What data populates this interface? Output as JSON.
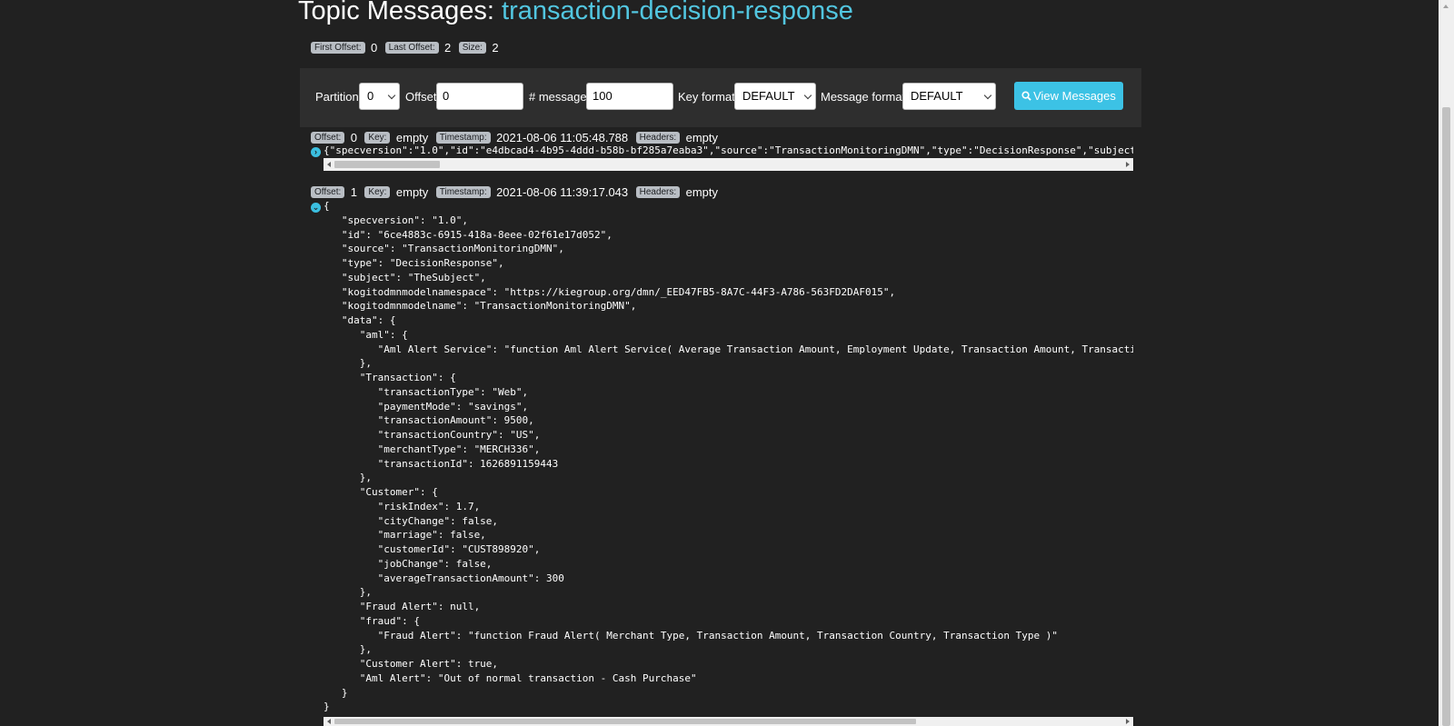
{
  "header": {
    "title_prefix": "Topic Messages: ",
    "topic_name": "transaction-decision-response"
  },
  "stats": {
    "first_offset_label": "First Offset:",
    "first_offset": "0",
    "last_offset_label": "Last Offset:",
    "last_offset": "2",
    "size_label": "Size:",
    "size": "2"
  },
  "controls": {
    "partition_label": "Partition",
    "partition_value": "0",
    "offset_label": "Offset",
    "offset_value": "0",
    "messages_label": "# messages",
    "messages_value": "100",
    "key_format_label": "Key format",
    "key_format_value": "DEFAULT",
    "message_format_label": "Message format",
    "message_format_value": "DEFAULT",
    "view_button_label": "View Messages",
    "view_button_icon": "search-icon"
  },
  "messages": [
    {
      "offset_label": "Offset:",
      "offset": "0",
      "key_label": "Key:",
      "key": "empty",
      "timestamp_label": "Timestamp:",
      "timestamp": "2021-08-06 11:05:48.788",
      "headers_label": "Headers:",
      "headers": "empty",
      "expanded": false,
      "body": "{\"specversion\":\"1.0\",\"id\":\"e4dbcad4-4b95-4ddd-b58b-bf285a7eaba3\",\"source\":\"TransactionMonitoringDMN\",\"type\":\"DecisionResponse\",\"subject"
    },
    {
      "offset_label": "Offset:",
      "offset": "1",
      "key_label": "Key:",
      "key": "empty",
      "timestamp_label": "Timestamp:",
      "timestamp": "2021-08-06 11:39:17.043",
      "headers_label": "Headers:",
      "headers": "empty",
      "expanded": true,
      "body": "{\n   \"specversion\": \"1.0\",\n   \"id\": \"6ce4883c-6915-418a-8eee-02f61e17d052\",\n   \"source\": \"TransactionMonitoringDMN\",\n   \"type\": \"DecisionResponse\",\n   \"subject\": \"TheSubject\",\n   \"kogitodmnmodelnamespace\": \"https://kiegroup.org/dmn/_EED47FB5-8A7C-44F3-A786-563FD2DAF015\",\n   \"kogitodmnmodelname\": \"TransactionMonitoringDMN\",\n   \"data\": {\n      \"aml\": {\n         \"Aml Alert Service\": \"function Aml Alert Service( Average Transaction Amount, Employment Update, Transaction Amount, Transactio\n      },\n      \"Transaction\": {\n         \"transactionType\": \"Web\",\n         \"paymentMode\": \"savings\",\n         \"transactionAmount\": 9500,\n         \"transactionCountry\": \"US\",\n         \"merchantType\": \"MERCH336\",\n         \"transactionId\": 1626891159443\n      },\n      \"Customer\": {\n         \"riskIndex\": 1.7,\n         \"cityChange\": false,\n         \"marriage\": false,\n         \"customerId\": \"CUST898920\",\n         \"jobChange\": false,\n         \"averageTransactionAmount\": 300\n      },\n      \"Fraud Alert\": null,\n      \"fraud\": {\n         \"Fraud Alert\": \"function Fraud Alert( Merchant Type, Transaction Amount, Transaction Country, Transaction Type )\"\n      },\n      \"Customer Alert\": true,\n      \"Aml Alert\": \"Out of normal transaction - Cash Purchase\"\n   }\n}"
    }
  ]
}
